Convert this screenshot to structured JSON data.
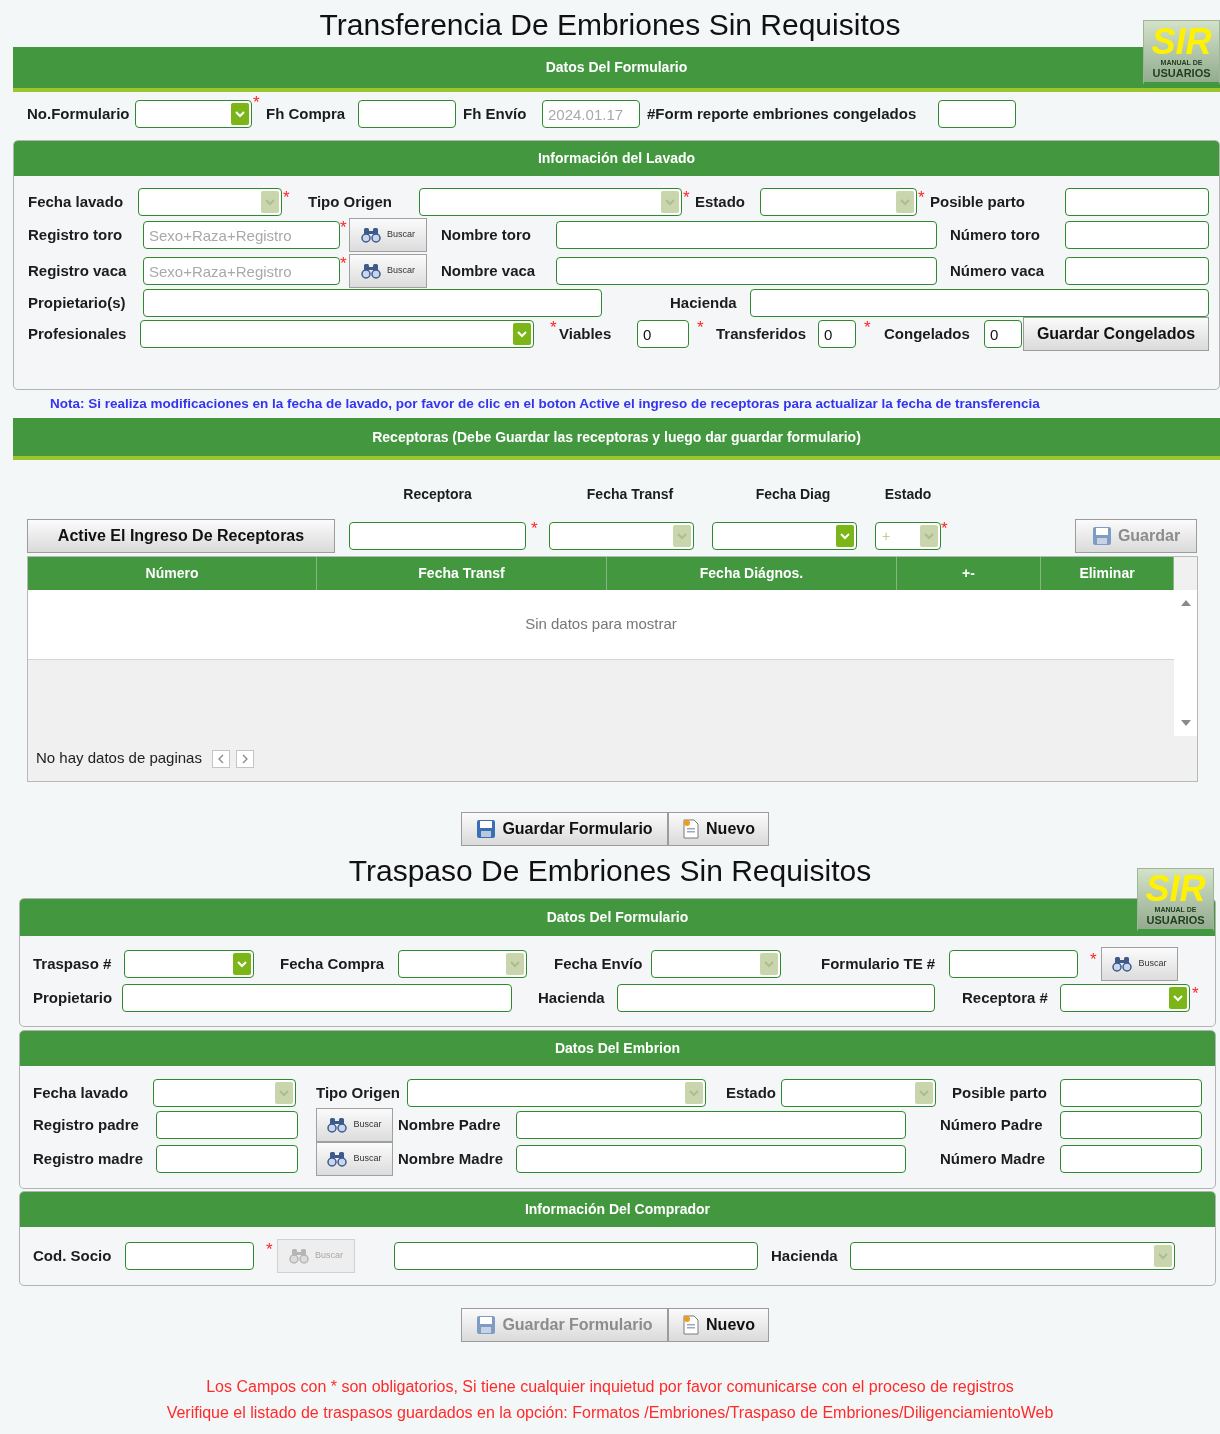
{
  "forms": [
    {
      "title": "Transferencia De Embriones Sin Requisitos",
      "logo": {
        "title": "SIR",
        "line_1": "MANUAL DE",
        "line_2": "USUARIOS"
      },
      "sections": [
        {
          "kind": "banner",
          "title": "Datos Del Formulario",
          "rows": [
            {
              "items": [
                {
                  "kind": "label",
                  "text": "No.Formulario"
                },
                {
                  "kind": "select",
                  "disabled": false
                },
                {
                  "kind": "mark",
                  "text": "*"
                },
                {
                  "kind": "label",
                  "text": "Fh Compra"
                },
                {
                  "kind": "input"
                },
                {
                  "kind": "label",
                  "text": "Fh Envío"
                },
                {
                  "kind": "input",
                  "placeholder": "2024.01.17"
                },
                {
                  "kind": "label",
                  "text": "#Form reporte embriones congelados"
                },
                {
                  "kind": "input"
                }
              ]
            }
          ]
        },
        {
          "kind": "card",
          "title": "Información del Lavado",
          "rows": [
            {
              "items": [
                {
                  "kind": "label",
                  "text": "Fecha lavado"
                },
                {
                  "kind": "select",
                  "disabled": true
                },
                {
                  "kind": "mark",
                  "text": "*"
                },
                {
                  "kind": "label",
                  "text": "Tipo Origen"
                },
                {
                  "kind": "select",
                  "disabled": true
                },
                {
                  "kind": "mark",
                  "text": "*"
                },
                {
                  "kind": "label",
                  "text": "Estado"
                },
                {
                  "kind": "select",
                  "disabled": true
                },
                {
                  "kind": "mark",
                  "text": "*"
                },
                {
                  "kind": "label",
                  "text": "Posible parto"
                },
                {
                  "kind": "input"
                }
              ]
            },
            {
              "items": [
                {
                  "kind": "label",
                  "text": "Registro toro"
                },
                {
                  "kind": "input",
                  "placeholder": "Sexo+Raza+Registro"
                },
                {
                  "kind": "mark",
                  "text": "*"
                },
                {
                  "kind": "search",
                  "label": "Buscar",
                  "disabled": false
                },
                {
                  "kind": "label",
                  "text": "Nombre toro"
                },
                {
                  "kind": "input"
                },
                {
                  "kind": "label",
                  "text": "Número toro"
                },
                {
                  "kind": "input"
                }
              ]
            },
            {
              "items": [
                {
                  "kind": "label",
                  "text": "Registro vaca"
                },
                {
                  "kind": "input",
                  "placeholder": "Sexo+Raza+Registro"
                },
                {
                  "kind": "mark",
                  "text": "*"
                },
                {
                  "kind": "search",
                  "label": "Buscar",
                  "disabled": false
                },
                {
                  "kind": "label",
                  "text": "Nombre vaca"
                },
                {
                  "kind": "input"
                },
                {
                  "kind": "label",
                  "text": "Número vaca"
                },
                {
                  "kind": "input"
                }
              ]
            },
            {
              "items": [
                {
                  "kind": "label",
                  "text": "Propietario(s)"
                },
                {
                  "kind": "input"
                },
                {
                  "kind": "label",
                  "text": "Hacienda"
                },
                {
                  "kind": "input"
                }
              ]
            },
            {
              "items": [
                {
                  "kind": "label",
                  "text": "Profesionales"
                },
                {
                  "kind": "select",
                  "disabled": false
                },
                {
                  "kind": "mark",
                  "text": "*"
                },
                {
                  "kind": "label",
                  "text": "Viables"
                },
                {
                  "kind": "input",
                  "value": "0"
                },
                {
                  "kind": "mark",
                  "text": "*"
                },
                {
                  "kind": "label",
                  "text": "Transferidos"
                },
                {
                  "kind": "input",
                  "value": "0"
                },
                {
                  "kind": "mark",
                  "text": "*"
                },
                {
                  "kind": "label",
                  "text": "Congelados"
                },
                {
                  "kind": "input",
                  "value": "0"
                },
                {
                  "kind": "button",
                  "label": "Guardar Congelados",
                  "disabled": false
                }
              ]
            }
          ]
        }
      ],
      "note": "Nota: Si realiza modificaciones en la fecha de lavado, por favor de clic en el boton Active el ingreso de receptoras para actualizar la fecha de transferencia",
      "receptoras": {
        "title": "Receptoras (Debe Guardar las receptoras y luego dar guardar formulario)",
        "column_labels": [
          "Receptora",
          "Fecha Transf",
          "Fecha Diag",
          "Estado"
        ],
        "controls": [
          {
            "kind": "button",
            "label": "Active El Ingreso De Receptoras",
            "disabled": false
          },
          {
            "kind": "input"
          },
          {
            "kind": "mark",
            "text": "*"
          },
          {
            "kind": "select",
            "disabled": true
          },
          {
            "kind": "select",
            "disabled": false
          },
          {
            "kind": "select",
            "value": "+",
            "disabled": true
          },
          {
            "kind": "mark",
            "text": "*"
          },
          {
            "kind": "button",
            "label": "Guardar",
            "disabled": true
          }
        ],
        "table": {
          "columns": [
            "Número",
            "Fecha Transf",
            "Fecha Diágnos.",
            "+-",
            "Eliminar"
          ],
          "empty_text": "Sin datos para mostrar",
          "pager_text": "No hay datos de paginas"
        }
      },
      "buttons": [
        {
          "kind": "button",
          "label": "Guardar Formulario",
          "disabled": false
        },
        {
          "kind": "button",
          "label": "Nuevo",
          "disabled": false
        }
      ]
    },
    {
      "title": "Traspaso De Embriones Sin Requisitos",
      "logo": {
        "title": "SIR",
        "line_1": "MANUAL DE",
        "line_2": "USUARIOS"
      },
      "sections": [
        {
          "kind": "card",
          "title": "Datos Del Formulario",
          "rows": [
            {
              "items": [
                {
                  "kind": "label",
                  "text": "Traspaso #"
                },
                {
                  "kind": "select",
                  "disabled": false
                },
                {
                  "kind": "label",
                  "text": "Fecha Compra"
                },
                {
                  "kind": "select",
                  "disabled": true
                },
                {
                  "kind": "label",
                  "text": "Fecha Envío"
                },
                {
                  "kind": "select",
                  "disabled": true
                },
                {
                  "kind": "label",
                  "text": "Formulario TE #"
                },
                {
                  "kind": "input"
                },
                {
                  "kind": "mark",
                  "text": "*"
                },
                {
                  "kind": "search",
                  "label": "Buscar",
                  "disabled": false
                }
              ]
            },
            {
              "items": [
                {
                  "kind": "label",
                  "text": "Propietario"
                },
                {
                  "kind": "input"
                },
                {
                  "kind": "label",
                  "text": "Hacienda"
                },
                {
                  "kind": "input"
                },
                {
                  "kind": "label",
                  "text": "Receptora #"
                },
                {
                  "kind": "select",
                  "disabled": false
                },
                {
                  "kind": "mark",
                  "text": "*"
                }
              ]
            }
          ]
        },
        {
          "kind": "card",
          "title": "Datos Del Embrion",
          "rows": [
            {
              "items": [
                {
                  "kind": "label",
                  "text": "Fecha lavado"
                },
                {
                  "kind": "select",
                  "disabled": true
                },
                {
                  "kind": "label",
                  "text": "Tipo Origen"
                },
                {
                  "kind": "select",
                  "disabled": true
                },
                {
                  "kind": "label",
                  "text": "Estado"
                },
                {
                  "kind": "select",
                  "disabled": true
                },
                {
                  "kind": "label",
                  "text": "Posible parto"
                },
                {
                  "kind": "input"
                }
              ]
            },
            {
              "items": [
                {
                  "kind": "label",
                  "text": "Registro padre"
                },
                {
                  "kind": "input"
                },
                {
                  "kind": "search",
                  "label": "Buscar",
                  "disabled": false
                },
                {
                  "kind": "label",
                  "text": "Nombre Padre"
                },
                {
                  "kind": "input"
                },
                {
                  "kind": "label",
                  "text": "Número Padre"
                },
                {
                  "kind": "input"
                }
              ]
            },
            {
              "items": [
                {
                  "kind": "label",
                  "text": "Registro madre"
                },
                {
                  "kind": "input"
                },
                {
                  "kind": "search",
                  "label": "Buscar",
                  "disabled": false
                },
                {
                  "kind": "label",
                  "text": "Nombre Madre"
                },
                {
                  "kind": "input"
                },
                {
                  "kind": "label",
                  "text": "Número Madre"
                },
                {
                  "kind": "input"
                }
              ]
            }
          ]
        },
        {
          "kind": "card",
          "title": "Información Del Comprador",
          "rows": [
            {
              "items": [
                {
                  "kind": "label",
                  "text": "Cod. Socio"
                },
                {
                  "kind": "input"
                },
                {
                  "kind": "mark",
                  "text": "*"
                },
                {
                  "kind": "search",
                  "label": "Buscar",
                  "disabled": true
                },
                {
                  "kind": "input"
                },
                {
                  "kind": "label",
                  "text": "Hacienda"
                },
                {
                  "kind": "select",
                  "disabled": true
                }
              ]
            }
          ]
        }
      ],
      "buttons": [
        {
          "kind": "button",
          "label": "Guardar Formulario",
          "disabled": true
        },
        {
          "kind": "button",
          "label": "Nuevo",
          "disabled": false
        }
      ]
    }
  ],
  "footer": [
    "Los Campos con * son obligatorios, Si tiene cualquier inquietud por favor comunicarse con el proceso de registros",
    "Verifique el listado de traspasos guardados en la opción: Formatos /Embriones/Traspaso de Embriones/DiligenciamientoWeb"
  ]
}
